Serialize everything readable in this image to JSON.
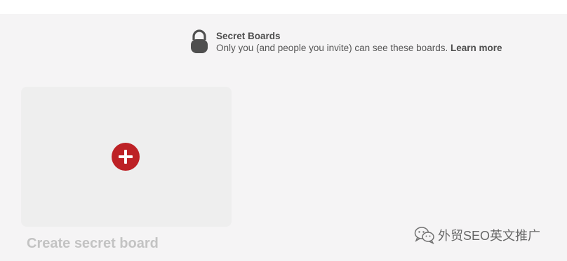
{
  "secret_boards": {
    "title": "Secret Boards",
    "description": "Only you (and people you invite) can see these boards.",
    "learn_more": "Learn more"
  },
  "create_board": {
    "label": "Create secret board"
  },
  "watermark": {
    "text": "外贸SEO英文推广"
  },
  "icons": {
    "lock": "lock-icon",
    "add": "plus-circle-icon",
    "watermark": "wechat-icon"
  },
  "colors": {
    "background": "#f5f4f5",
    "card": "#eeeeee",
    "accent_red": "#bd2125",
    "muted_text": "#c3c3c3"
  }
}
